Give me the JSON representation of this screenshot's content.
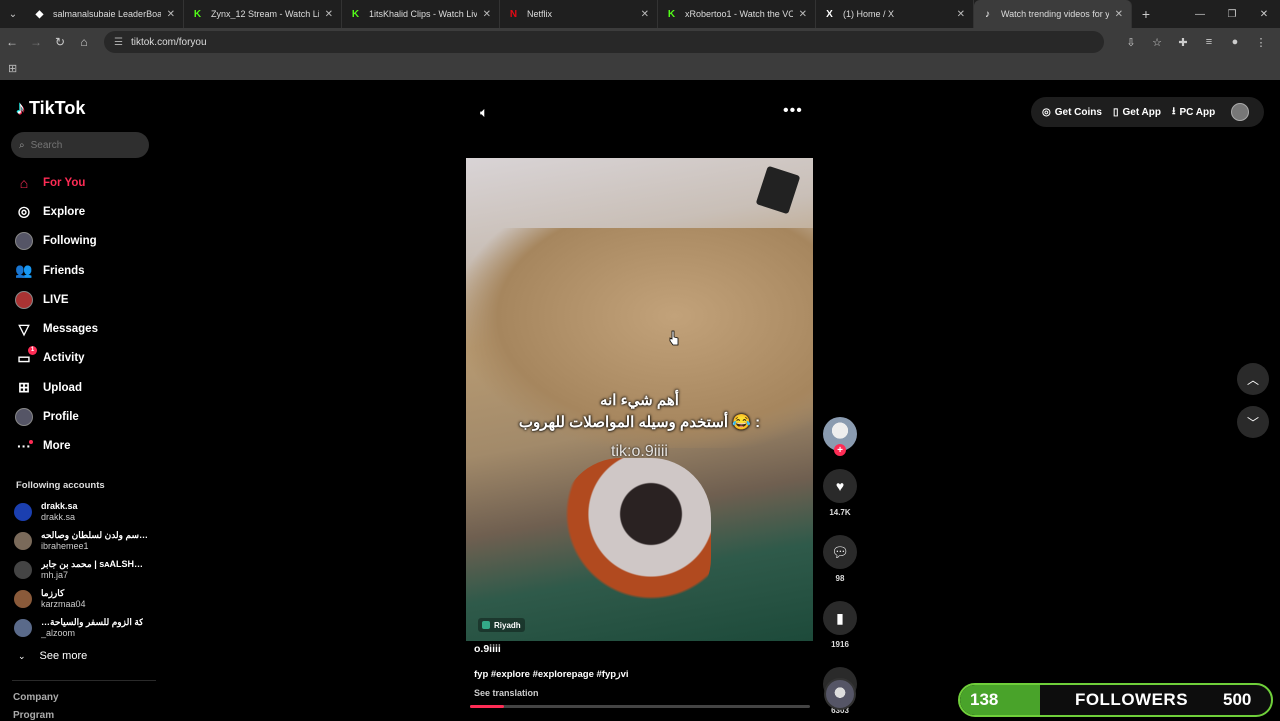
{
  "browser": {
    "tabs": [
      {
        "icon": "◆",
        "title": "salmanalsubaie LeaderBoard | T",
        "color": "#fff"
      },
      {
        "icon": "K",
        "title": "Zynx_12 Stream - Watch Live on",
        "color": "#53fc18"
      },
      {
        "icon": "K",
        "title": "1itsKhalid Clips - Watch Live on",
        "color": "#53fc18"
      },
      {
        "icon": "N",
        "title": "Netflix",
        "color": "#e50914"
      },
      {
        "icon": "K",
        "title": "xRobertoo1 - Watch the VOD o",
        "color": "#53fc18"
      },
      {
        "icon": "X",
        "title": "(1) Home / X",
        "color": "#fff"
      },
      {
        "icon": "♪",
        "title": "Watch trending videos for you",
        "color": "#fff"
      }
    ],
    "url": "tiktok.com/foryou"
  },
  "sidebar": {
    "brand": "TikTok",
    "search_placeholder": "Search",
    "nav": [
      {
        "label": "For You",
        "icon": "⌂"
      },
      {
        "label": "Explore",
        "icon": "◎"
      },
      {
        "label": "Following",
        "icon": "●"
      },
      {
        "label": "Friends",
        "icon": "👥"
      },
      {
        "label": "LIVE",
        "icon": "●"
      },
      {
        "label": "Messages",
        "icon": "▽"
      },
      {
        "label": "Activity",
        "icon": "▭",
        "badge": "1"
      },
      {
        "label": "Upload",
        "icon": "⊞"
      },
      {
        "label": "Profile",
        "icon": "●"
      },
      {
        "label": "More",
        "icon": "···"
      }
    ],
    "following_title": "Following accounts",
    "following": [
      {
        "n1": "drakk.sa",
        "n2": "drakk.sa",
        "color": "#1b3fb0"
      },
      {
        "n1": "سم ولدن لسلطان وصالحه…",
        "n2": "ibrahemee1",
        "color": "#7a6a5a"
      },
      {
        "n1": "محمد بن جابر | ѕᴀALSH…",
        "n2": "mh.ja7",
        "color": "#444"
      },
      {
        "n1": "كارزما",
        "n2": "karzmaa04",
        "color": "#8a5a3a"
      },
      {
        "n1": "…كة الزوم للسفر والسياحة",
        "n2": "_alzoom",
        "color": "#5a6a8a"
      }
    ],
    "see_more": "See more",
    "company": "Company",
    "program": "Program"
  },
  "topbar": {
    "get_coins": "Get Coins",
    "get_app": "Get App",
    "pc_app": "PC App"
  },
  "video": {
    "caption_line1": "أهم شيء انه",
    "caption_line2": "أستخدم وسيله المواصلات للهروب 😂 :",
    "watermark": "tik:o.9iiii",
    "location": "Riyadh",
    "author": "o.9iiii",
    "description": "fyp #explore #explorepage #fypزvi",
    "see_translation": "See translation",
    "progress": 0.1
  },
  "actions": {
    "likes": "14.7K",
    "comments": "98",
    "saves": "1916",
    "shares": "6303"
  },
  "followers_widget": {
    "current": "138",
    "label": "FOLLOWERS",
    "goal": "500"
  }
}
